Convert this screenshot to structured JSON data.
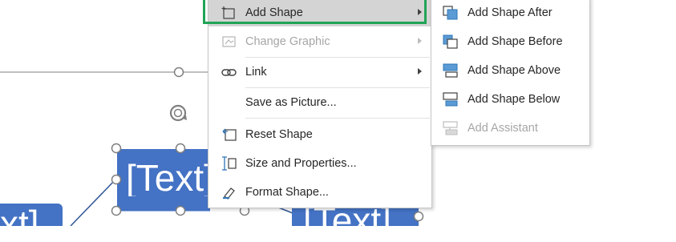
{
  "canvas": {
    "shape_left_text": "[Text]",
    "shape_right_text": "[Text]",
    "partial_text": "xt]",
    "shape_color": "#4472c4",
    "connector_color": "#2f5597"
  },
  "context_menu": {
    "items": [
      {
        "label": "Add Shape",
        "icon": "add-shape-icon",
        "submenu": true,
        "highlighted": true,
        "enabled": true
      },
      {
        "label": "Change Graphic",
        "icon": "change-graphic-icon",
        "submenu": true,
        "enabled": false
      },
      {
        "label": "Link",
        "icon": "link-icon",
        "submenu": true,
        "enabled": true
      },
      {
        "label": "Save as Picture...",
        "icon": "",
        "submenu": false,
        "enabled": true
      },
      {
        "label": "Reset Shape",
        "icon": "reset-shape-icon",
        "submenu": false,
        "enabled": true
      },
      {
        "label": "Size and Properties...",
        "icon": "size-properties-icon",
        "submenu": false,
        "enabled": true
      },
      {
        "label": "Format Shape...",
        "icon": "format-shape-icon",
        "submenu": false,
        "enabled": true
      }
    ]
  },
  "submenu": {
    "items": [
      {
        "label": "Add Shape After",
        "icon": "add-shape-after-icon",
        "enabled": true
      },
      {
        "label": "Add Shape Before",
        "icon": "add-shape-before-icon",
        "enabled": true
      },
      {
        "label": "Add Shape Above",
        "icon": "add-shape-above-icon",
        "enabled": true
      },
      {
        "label": "Add Shape Below",
        "icon": "add-shape-below-icon",
        "enabled": true
      },
      {
        "label": "Add Assistant",
        "icon": "add-assistant-icon",
        "enabled": false
      }
    ]
  },
  "colors": {
    "highlight_border": "#20a456",
    "hover_background": "#d4d4d4",
    "icon_blue": "#5b9bd5"
  }
}
